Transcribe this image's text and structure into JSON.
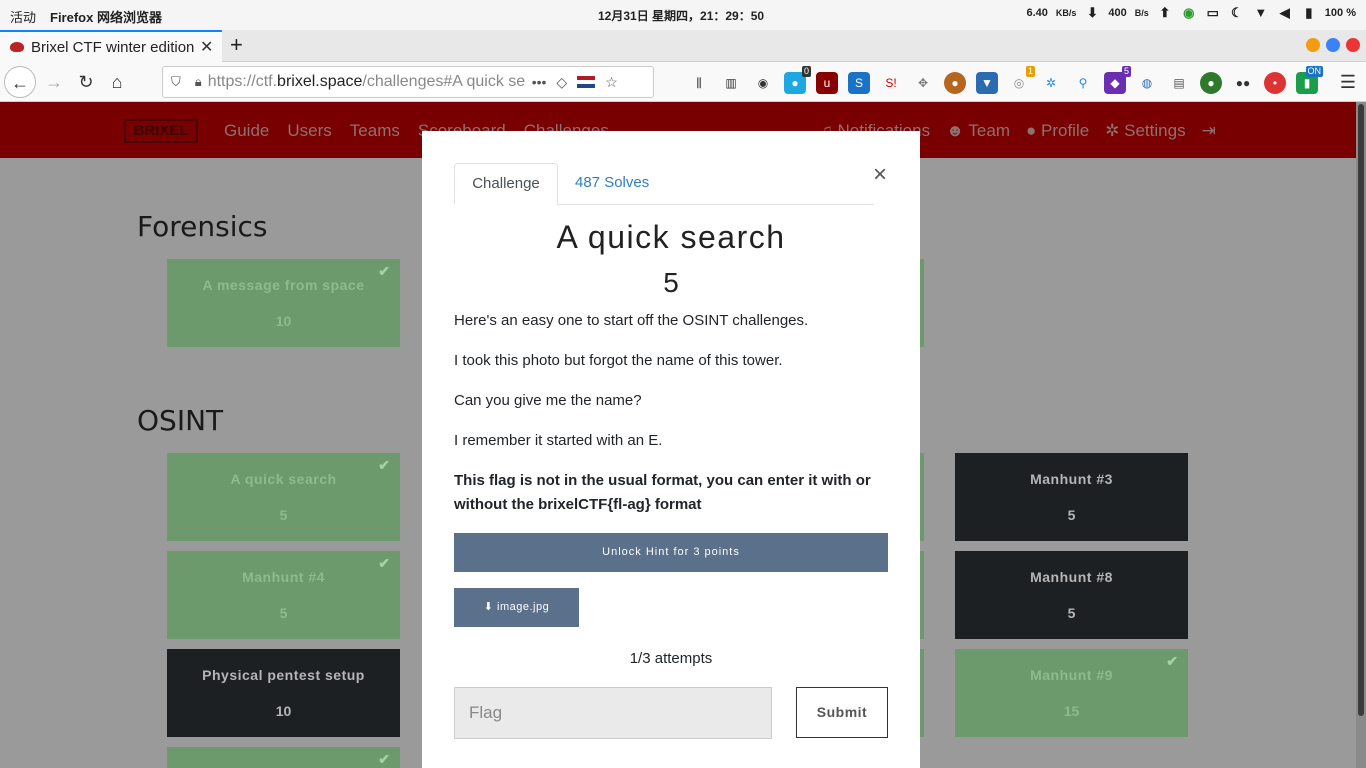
{
  "system_bar": {
    "activities": "活动",
    "app_name": "Firefox 网络浏览器",
    "clock": "12月31日 星期四，21：29：50",
    "download_speed": "6.40",
    "download_unit": "KB/s",
    "upload_speed": "400",
    "upload_unit": "B/s",
    "battery": "100 %"
  },
  "browser": {
    "tab_title": "Brixel CTF winter edition",
    "url_prefix": "https://ctf.",
    "url_domain": "brixel.space",
    "url_path": "/challenges#A quick se",
    "extension_badges": [
      "0",
      "1",
      "5",
      "ON"
    ]
  },
  "site_nav": {
    "logo": "BRIXEL",
    "links": [
      "Guide",
      "Users",
      "Teams",
      "Scoreboard",
      "Challenges"
    ],
    "right_links": [
      "Notifications",
      "Team",
      "Profile",
      "Settings"
    ]
  },
  "sections": {
    "forensics": "Forensics",
    "osint": "OSINT"
  },
  "cards": {
    "message_space": {
      "name": "A message from space",
      "value": "10"
    },
    "quick_search": {
      "name": "A quick search",
      "value": "5"
    },
    "manhunt4": {
      "name": "Manhunt #4",
      "value": "5"
    },
    "pentest": {
      "name": "Physical pentest setup",
      "value": "10"
    },
    "manhunt3": {
      "name": "Manhunt #3",
      "value": "5"
    },
    "manhunt8": {
      "name": "Manhunt #8",
      "value": "5"
    },
    "manhunt9": {
      "name": "Manhunt #9",
      "value": "15"
    }
  },
  "modal": {
    "tab_challenge": "Challenge",
    "tab_solves": "487 Solves",
    "title": "A quick search",
    "value": "5",
    "description": [
      "Here's an easy one to start off the OSINT challenges.",
      "I took this photo but forgot the name of this tower.",
      "Can you give me the name?",
      "I remember it started with an E."
    ],
    "note": "This flag is not in the usual format, you can enter it with or without the brixelCTF{fl-ag} format",
    "hint_button": "Unlock Hint for 3 points",
    "file_button": "image.jpg",
    "attempts": "1/3 attempts",
    "flag_placeholder": "Flag",
    "submit": "Submit"
  },
  "colors": {
    "site_nav": "#780000",
    "solved_card": "#6c9a6c",
    "unsolved_card": "#1d2023",
    "button": "#5a708b",
    "link": "#2f7ec1"
  }
}
